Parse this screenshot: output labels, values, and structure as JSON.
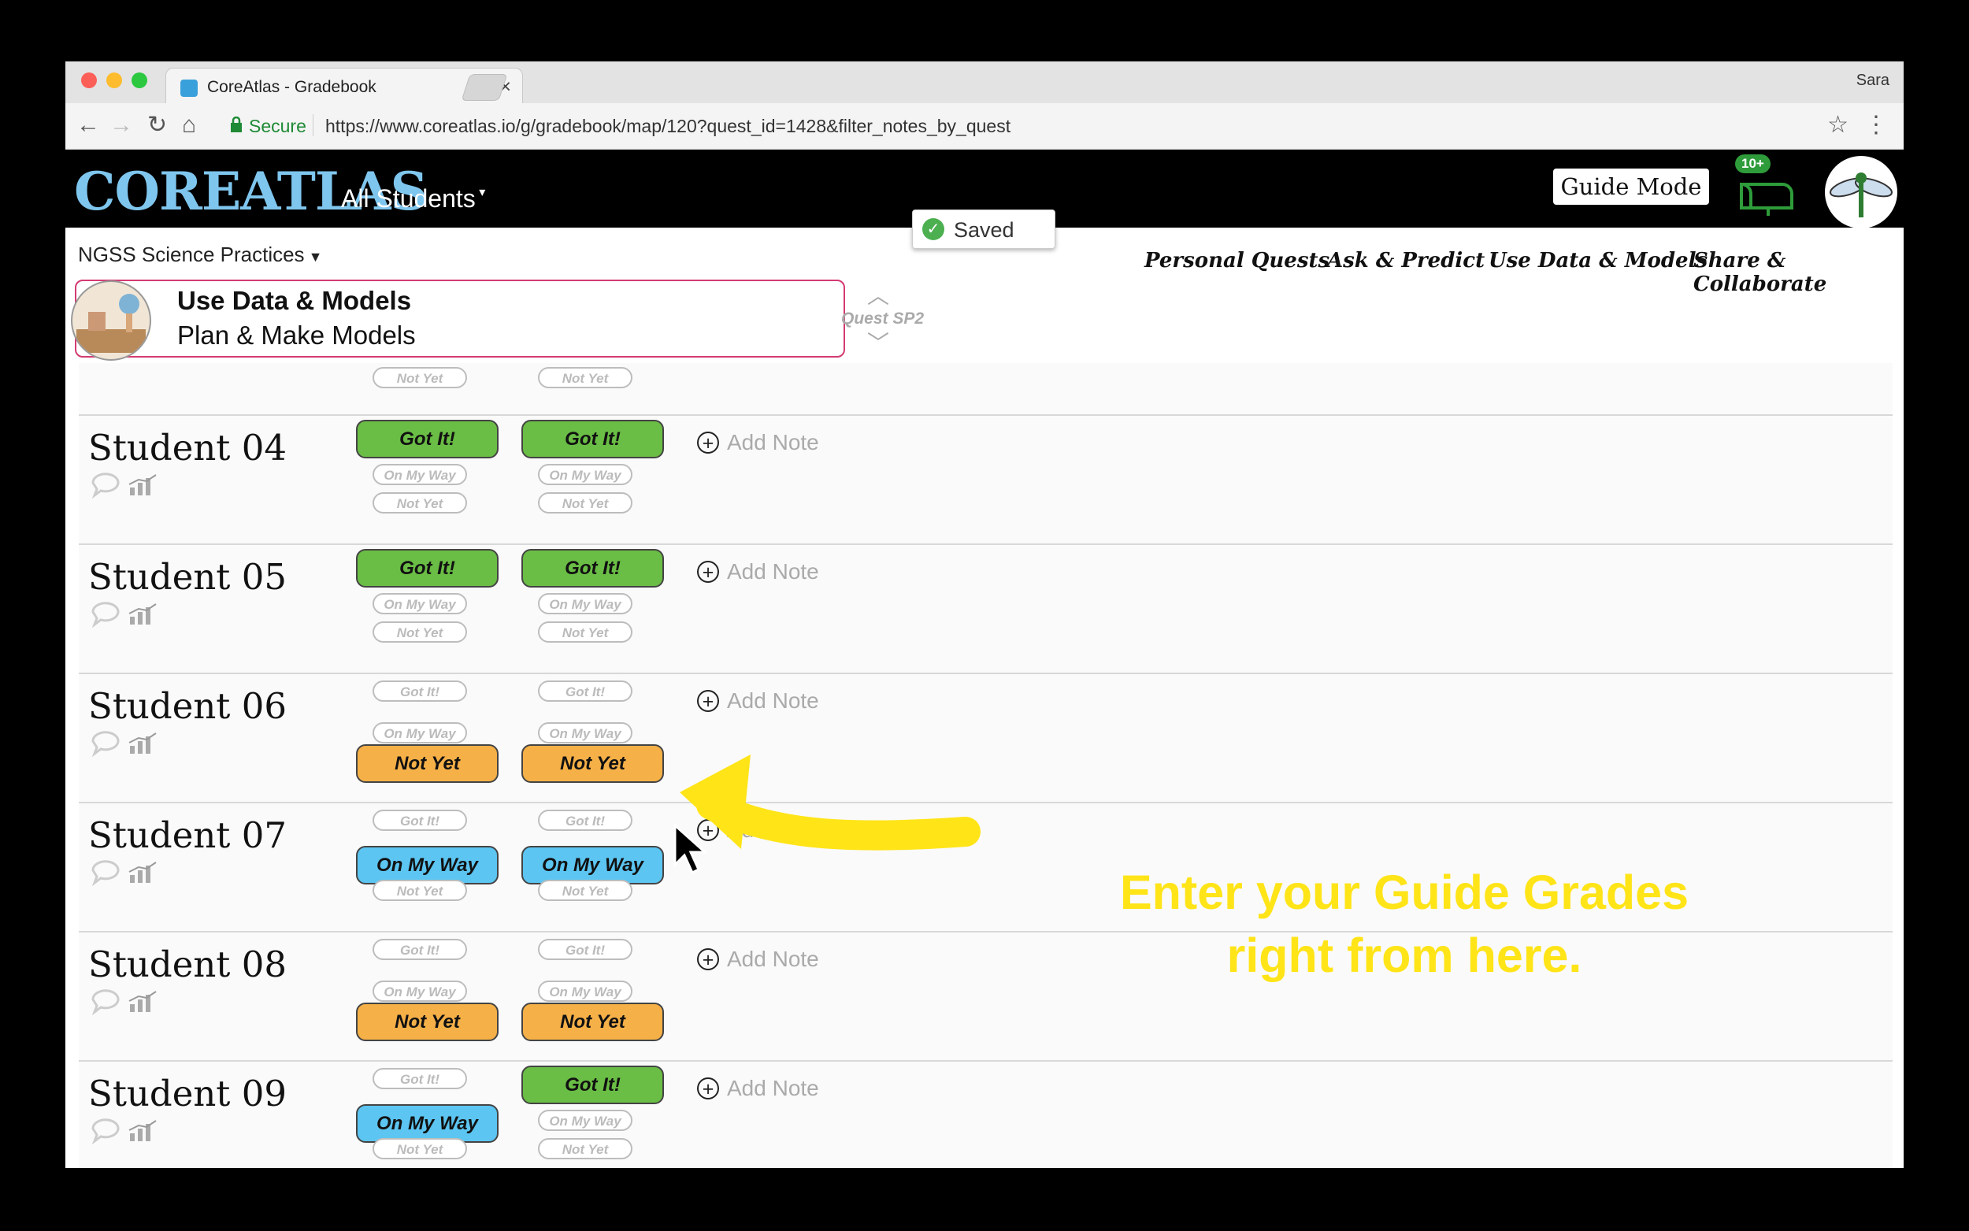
{
  "browser": {
    "tab_title": "CoreAtlas - Gradebook",
    "user": "Sara",
    "secure_label": "Secure",
    "url": "https://www.coreatlas.io/g/gradebook/map/120?quest_id=1428&filter_notes_by_quest"
  },
  "app": {
    "logo": "CoreAtlas",
    "students_dropdown": "All Students",
    "guide_mode": "Guide Mode",
    "mail_badge": "10+",
    "saved": "Saved"
  },
  "toolbar": {
    "standards_dropdown": "NGSS Science Practices",
    "nav": [
      "Personal Quests",
      "Ask & Predict",
      "Use Data & Models",
      "Share & Collaborate"
    ]
  },
  "quest": {
    "title": "Use Data & Models",
    "subtitle": "Plan & Make Models",
    "label": "Quest SP2"
  },
  "grade_labels": {
    "got": "Got It!",
    "way": "On My Way",
    "not": "Not Yet"
  },
  "add_note": "Add Note",
  "partial_row": {
    "col1": "Not Yet",
    "col2": "Not Yet"
  },
  "students": [
    {
      "name": "Student 04",
      "grades": [
        "got",
        "got"
      ]
    },
    {
      "name": "Student 05",
      "grades": [
        "got",
        "got"
      ]
    },
    {
      "name": "Student 06",
      "grades": [
        "not",
        "not"
      ]
    },
    {
      "name": "Student 07",
      "grades": [
        "way",
        "way"
      ]
    },
    {
      "name": "Student 08",
      "grades": [
        "not",
        "not"
      ]
    },
    {
      "name": "Student 09",
      "grades": [
        "way",
        "got"
      ]
    }
  ],
  "annotation": {
    "line1": "Enter your Guide Grades",
    "line2": "right from here."
  },
  "colors": {
    "got": "#6abd45",
    "way": "#5cc5f1",
    "not": "#f5b048",
    "annotation": "#ffe418",
    "quest_border": "#d43b72"
  }
}
